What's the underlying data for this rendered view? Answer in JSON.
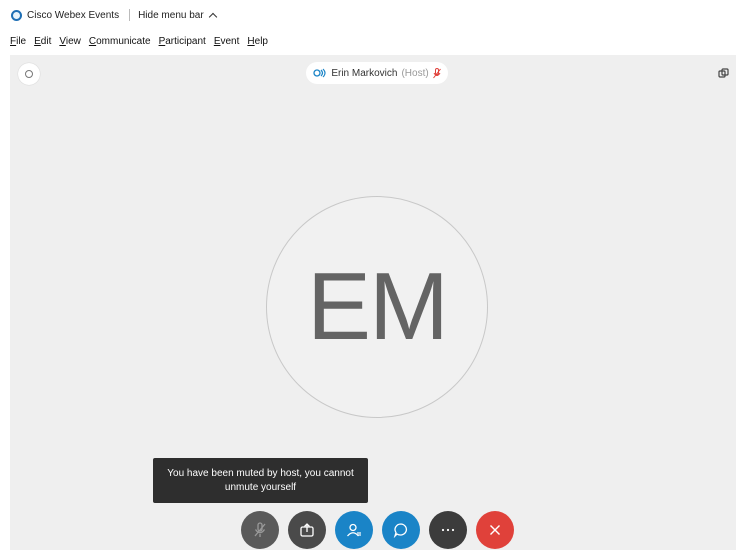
{
  "window": {
    "app_title": "Cisco Webex Events",
    "hide_menu_label": "Hide menu bar"
  },
  "menu": {
    "items": [
      "File",
      "Edit",
      "View",
      "Communicate",
      "Participant",
      "Event",
      "Help"
    ]
  },
  "stage": {
    "speaker_name": "Erin Markovich",
    "speaker_role": "(Host)",
    "avatar_initials": "EM",
    "toast_message": "You have been muted by host, you cannot unmute yourself"
  },
  "controls": [
    {
      "name": "mute-button",
      "icon": "microphone-muted-icon",
      "color": "#5a5a5a"
    },
    {
      "name": "share-button",
      "icon": "share-icon",
      "color": "#4a4a4a"
    },
    {
      "name": "participants-button",
      "icon": "participants-icon",
      "color": "#1a84c7"
    },
    {
      "name": "chat-button",
      "icon": "chat-icon",
      "color": "#1a84c7"
    },
    {
      "name": "more-button",
      "icon": "more-options-icon",
      "color": "#3c3c3c"
    },
    {
      "name": "leave-button",
      "icon": "close-icon",
      "color": "#e0413a"
    }
  ],
  "colors": {
    "accent": "#1a84c7",
    "danger": "#e0413a",
    "stage_bg": "#efefef",
    "toast_bg": "#2e2e2e"
  }
}
